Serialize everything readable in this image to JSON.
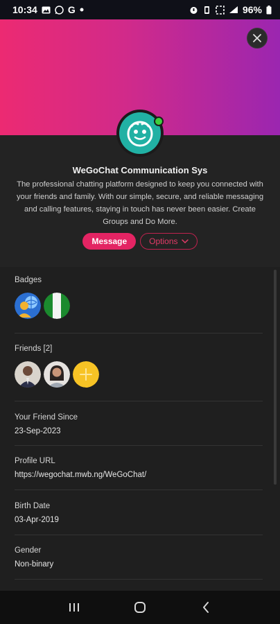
{
  "status_bar": {
    "time": "10:34",
    "battery": "96%"
  },
  "profile": {
    "name": "WeGoChat Communication Sys",
    "description": "The professional chatting platform designed to keep you connected with your friends and family. With our simple, secure, and reliable messaging and calling features, staying in touch has never been easier. Create Groups and Do More.",
    "online": true,
    "accent": "#e32463",
    "avatar_color": "#21b1a4"
  },
  "actions": {
    "message_label": "Message",
    "options_label": "Options"
  },
  "details": {
    "badges_label": "Badges",
    "badges": [
      "globe-user-badge",
      "nigeria-flag-badge"
    ],
    "friends_label": "Friends [2]",
    "friends": [
      "friend-man",
      "friend-woman",
      "add-friend"
    ],
    "friend_since_label": "Your Friend Since",
    "friend_since_value": "23-Sep-2023",
    "profile_url_label": "Profile URL",
    "profile_url_value": "https://wegochat.mwb.ng/WeGoChat/",
    "birth_date_label": "Birth Date",
    "birth_date_value": "03-Apr-2019",
    "gender_label": "Gender",
    "gender_value": "Non-binary"
  }
}
